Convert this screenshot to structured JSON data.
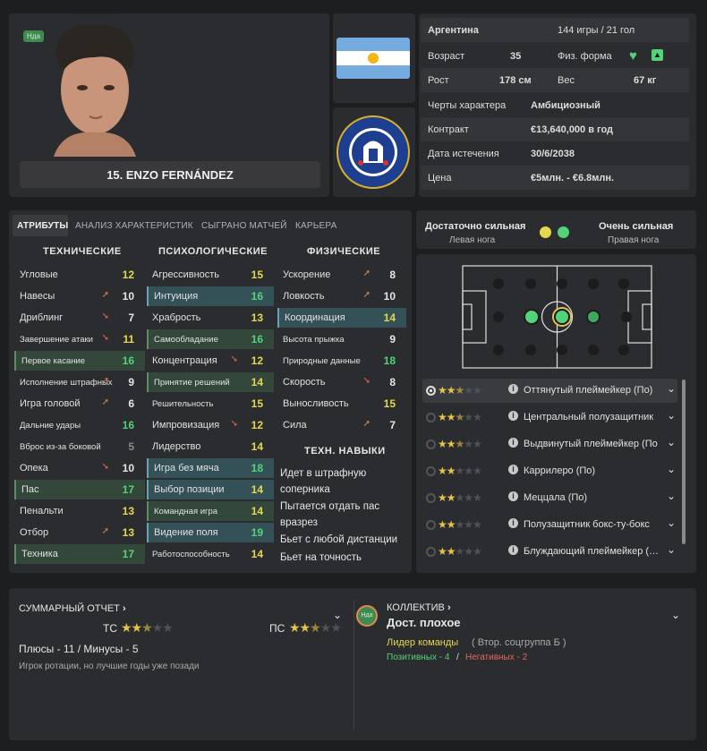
{
  "player": {
    "badge": "Нда",
    "name": "15. ENZO FERNÁNDEZ"
  },
  "info": {
    "nation": "Аргентина",
    "caps": "144 игры / 21 гол",
    "age_label": "Возраст",
    "age": "35",
    "fitness_label": "Физ. форма",
    "height_label": "Рост",
    "height": "178 см",
    "weight_label": "Вес",
    "weight": "67 кг",
    "personality_label": "Черты характера",
    "personality": "Амбициозный",
    "contract_label": "Контракт",
    "contract": "€13,640,000 в год",
    "expiry_label": "Дата истечения",
    "expiry": "30/6/2038",
    "value_label": "Цена",
    "value": "€5млн. - €6.8млн."
  },
  "tabs": [
    "АТРИБУТЫ",
    "АНАЛИЗ ХАРАКТЕРИСТИК",
    "СЫГРАНО МАТЧЕЙ",
    "КАРЬЕРА"
  ],
  "columns": {
    "technical": "ТЕХНИЧЕСКИЕ",
    "mental": "ПСИХОЛОГИЧЕСКИЕ",
    "physical": "ФИЗИЧЕСКИЕ",
    "skills": "ТЕХН. НАВЫКИ"
  },
  "technical": [
    {
      "name": "Угловые",
      "value": "12",
      "color": "y",
      "arrow": "",
      "hl": ""
    },
    {
      "name": "Навесы",
      "value": "10",
      "color": "w",
      "arrow": "up",
      "hl": ""
    },
    {
      "name": "Дриблинг",
      "value": "7",
      "color": "w",
      "arrow": "dn",
      "hl": ""
    },
    {
      "name": "Завершение атаки",
      "value": "11",
      "color": "y",
      "arrow": "dn",
      "hl": "",
      "small": true
    },
    {
      "name": "Первое касание",
      "value": "16",
      "color": "g",
      "arrow": "",
      "hl": "gr",
      "small": true
    },
    {
      "name": "Исполнение штрафных",
      "value": "9",
      "color": "w",
      "arrow": "up",
      "hl": "",
      "small": true
    },
    {
      "name": "Игра головой",
      "value": "6",
      "color": "w",
      "arrow": "up",
      "hl": ""
    },
    {
      "name": "Дальние удары",
      "value": "16",
      "color": "g",
      "arrow": "",
      "hl": "",
      "small": true
    },
    {
      "name": "Вброс из-за боковой",
      "value": "5",
      "color": "gr",
      "arrow": "",
      "hl": "",
      "small": true
    },
    {
      "name": "Опека",
      "value": "10",
      "color": "w",
      "arrow": "dn",
      "hl": ""
    },
    {
      "name": "Пас",
      "value": "17",
      "color": "g",
      "arrow": "",
      "hl": "gr"
    },
    {
      "name": "Пенальти",
      "value": "13",
      "color": "y",
      "arrow": "",
      "hl": ""
    },
    {
      "name": "Отбор",
      "value": "13",
      "color": "y",
      "arrow": "up",
      "hl": ""
    },
    {
      "name": "Техника",
      "value": "17",
      "color": "g",
      "arrow": "",
      "hl": "gr"
    }
  ],
  "mental": [
    {
      "name": "Агрессивность",
      "value": "15",
      "color": "y",
      "arrow": "",
      "hl": ""
    },
    {
      "name": "Интуиция",
      "value": "16",
      "color": "g",
      "arrow": "",
      "hl": "hl"
    },
    {
      "name": "Храбрость",
      "value": "13",
      "color": "y",
      "arrow": "",
      "hl": ""
    },
    {
      "name": "Самообладание",
      "value": "16",
      "color": "g",
      "arrow": "",
      "hl": "gr",
      "small": true
    },
    {
      "name": "Концентрация",
      "value": "12",
      "color": "y",
      "arrow": "dn",
      "hl": ""
    },
    {
      "name": "Принятие решений",
      "value": "14",
      "color": "y",
      "arrow": "",
      "hl": "gr",
      "small": true
    },
    {
      "name": "Решительность",
      "value": "15",
      "color": "y",
      "arrow": "",
      "hl": "",
      "small": true
    },
    {
      "name": "Импровизация",
      "value": "12",
      "color": "y",
      "arrow": "dn",
      "hl": ""
    },
    {
      "name": "Лидерство",
      "value": "14",
      "color": "y",
      "arrow": "",
      "hl": ""
    },
    {
      "name": "Игра без мяча",
      "value": "18",
      "color": "g",
      "arrow": "",
      "hl": "hl"
    },
    {
      "name": "Выбор позиции",
      "value": "14",
      "color": "y",
      "arrow": "",
      "hl": "hl"
    },
    {
      "name": "Командная игра",
      "value": "14",
      "color": "y",
      "arrow": "",
      "hl": "gr",
      "small": true
    },
    {
      "name": "Видение поля",
      "value": "19",
      "color": "g",
      "arrow": "",
      "hl": "hl"
    },
    {
      "name": "Работоспособность",
      "value": "14",
      "color": "y",
      "arrow": "",
      "hl": "",
      "small": true
    }
  ],
  "physical": [
    {
      "name": "Ускорение",
      "value": "8",
      "color": "w",
      "arrow": "up",
      "hl": ""
    },
    {
      "name": "Ловкость",
      "value": "10",
      "color": "w",
      "arrow": "up",
      "hl": ""
    },
    {
      "name": "Координация",
      "value": "14",
      "color": "y",
      "arrow": "",
      "hl": "hl"
    },
    {
      "name": "Высота прыжка",
      "value": "9",
      "color": "w",
      "arrow": "",
      "hl": "",
      "small": true
    },
    {
      "name": "Природные данные",
      "value": "18",
      "color": "g",
      "arrow": "",
      "hl": "",
      "small": true
    },
    {
      "name": "Скорость",
      "value": "8",
      "color": "w",
      "arrow": "dn",
      "hl": ""
    },
    {
      "name": "Выносливость",
      "value": "15",
      "color": "y",
      "arrow": "",
      "hl": ""
    },
    {
      "name": "Сила",
      "value": "7",
      "color": "w",
      "arrow": "up",
      "hl": ""
    }
  ],
  "skills": [
    "Идет в штрафную соперника",
    "Пытается отдать пас вразрез",
    "Бьет с любой дистанции",
    "Бьет на точность"
  ],
  "feet": {
    "left_level": "Достаточно сильная",
    "left_label": "Левая нога",
    "right_level": "Очень сильная",
    "right_label": "Правая нога"
  },
  "roles": [
    {
      "name": "Оттянутый плеймейкер (По)",
      "stars": 2.5,
      "selected": true
    },
    {
      "name": "Центральный полузащитник",
      "stars": 2.5,
      "selected": false
    },
    {
      "name": "Выдвинутый плеймейкер (По)",
      "stars": 2.5,
      "selected": false
    },
    {
      "name": "Каррилеро (По)",
      "stars": 2,
      "selected": false
    },
    {
      "name": "Меццала (По)",
      "stars": 2,
      "selected": false
    },
    {
      "name": "Полузащитник бокс-ту-бокс",
      "stars": 2,
      "selected": false
    },
    {
      "name": "Блуждающий плеймейкер (…",
      "stars": 2,
      "selected": false
    }
  ],
  "summary": {
    "title": "СУММАРНЫЙ ОТЧЕТ",
    "ts": "ТС",
    "ps": "ПС",
    "plus_minus": "Плюсы - 11 / Минусы - 5",
    "note": "Игрок ротации, но лучшие годы уже позади"
  },
  "collective": {
    "title": "КОЛЛЕКТИВ",
    "status": "Дост. плохое",
    "leader": "Лидер команды",
    "group": "( Втор. соцгруппа Б )",
    "positive": "Позитивных - 4",
    "slash": "/",
    "negative": "Негативных - 2",
    "badge": "Нда"
  },
  "colors": {
    "green": "#52d37a",
    "yellow": "#e6d84e",
    "gold": "#e8c34a",
    "blue": "#4a78b5"
  }
}
